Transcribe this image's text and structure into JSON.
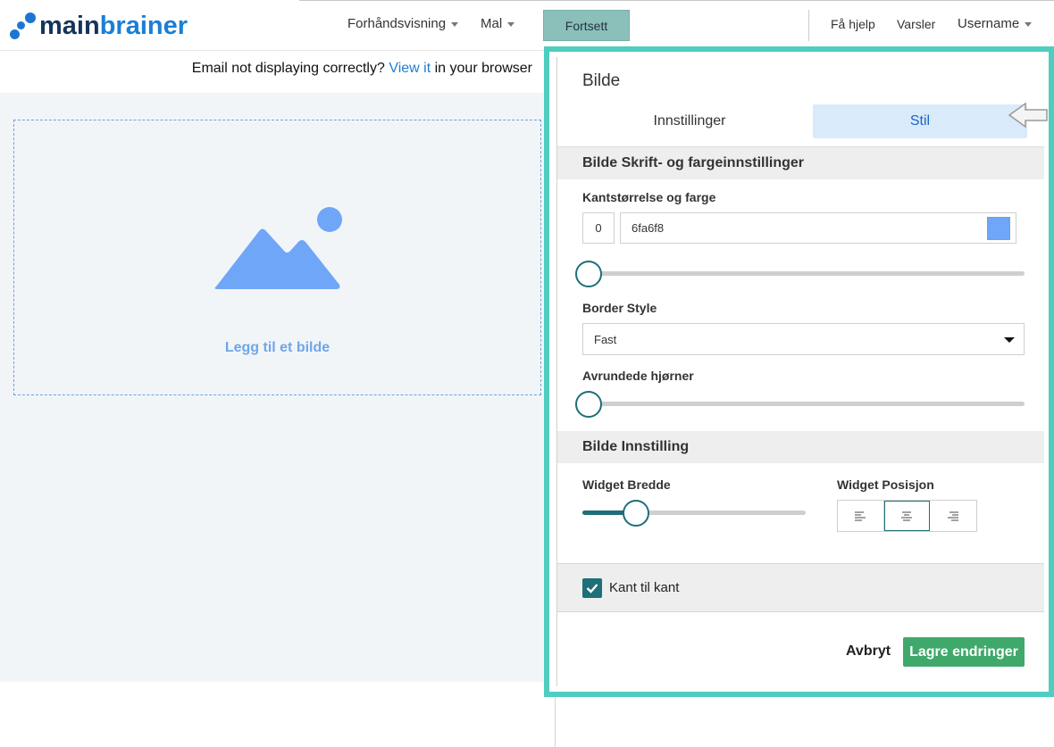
{
  "brand": {
    "part1": "main",
    "part2": "brainer"
  },
  "nav": {
    "preview_label": "Forhåndsvisning",
    "template_label": "Mal",
    "continue_label": "Fortsett",
    "help_label": "Få hjelp",
    "alerts_label": "Varsler",
    "user_label": "Username"
  },
  "email_notice": {
    "prefix": "Email not displaying correctly?",
    "link": "View it",
    "suffix": "in your browser"
  },
  "placeholder": {
    "label": "Legg til et bilde"
  },
  "panel": {
    "title": "Bilde",
    "tabs": [
      {
        "label": "Innstillinger",
        "active": false
      },
      {
        "label": "Stil",
        "active": true
      }
    ],
    "section_font_color": "Bilde Skrift- og fargeinnstillinger",
    "border_size_label": "Kantstørrelse og farge",
    "border_size_value": "0",
    "border_color_value": "6fa6f8",
    "border_color_swatch": "#6fa6f8",
    "border_size_slider": 0,
    "border_style_label": "Border Style",
    "border_style_value": "Fast",
    "rounded_corners_label": "Avrundede hjørner",
    "rounded_corners_slider": 0,
    "section_image": "Bilde Innstilling",
    "widget_width_label": "Widget Bredde",
    "widget_width_slider": 0.24,
    "widget_position_label": "Widget Posisjon",
    "widget_position_options": [
      "align-left-icon",
      "align-center-icon",
      "align-right-icon"
    ],
    "widget_position_selected": "center",
    "edge_to_edge_label": "Kant til kant",
    "edge_to_edge_checked": true,
    "cancel_label": "Avbryt",
    "save_label": "Lagre endringer"
  },
  "colors": {
    "accent_teal": "#4ecdc0",
    "slider": "#1e6f78",
    "save_green": "#3fa96b",
    "tab_active_bg": "#d9eafb",
    "placeholder_blue": "#6fa6e9"
  }
}
